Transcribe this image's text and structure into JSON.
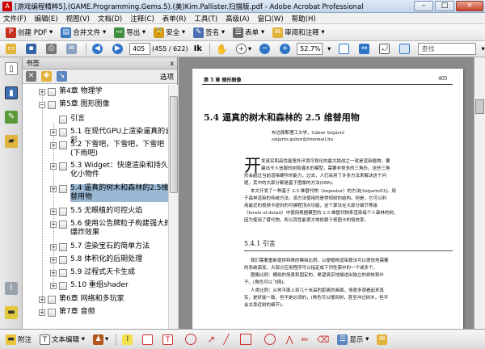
{
  "window": {
    "title": "[游戏编程精粹5].(GAME.Programming.Gems.5).(美)Kim.Pallister.扫描版.pdf - Adobe Acrobat Professional",
    "min": "–",
    "max": "□",
    "close": "×"
  },
  "menu": [
    "文件(F)",
    "编辑(E)",
    "视图(V)",
    "文档(D)",
    "注释(C)",
    "表单(R)",
    "工具(T)",
    "高级(A)",
    "窗口(W)",
    "帮助(H)"
  ],
  "toolbar1": {
    "create": "创建 PDF",
    "combine": "合并文件",
    "export": "导出",
    "secure": "安全",
    "sign": "签名",
    "forms": "表单",
    "review": "审阅和注释"
  },
  "toolbar2": {
    "page_current": "405",
    "page_total": "(455 / 622)",
    "zoom": "52.7%",
    "search_placeholder": "查找"
  },
  "panel": {
    "title": "书签",
    "close": "x",
    "options": "选项"
  },
  "bookmarks": [
    {
      "label": "第4章 物理学",
      "level": 1,
      "expander": "+"
    },
    {
      "label": "第5章 图形图像",
      "level": 1,
      "expander": "−"
    },
    {
      "label": "引言",
      "level": 2,
      "expander": ""
    },
    {
      "label": "5.1 在现代GPU上渲染逼真的云彩",
      "level": 2,
      "expander": "+"
    },
    {
      "label": "5.2 下雪吧，下雪吧，下雪吧(下雨吧)",
      "level": 2,
      "expander": "+"
    },
    {
      "label": "5.3 Widget：快速渲染和持久化小物件",
      "level": 2,
      "expander": "+"
    },
    {
      "label": "5.4 逼真的树木和森林的2.5维替用物",
      "level": 2,
      "expander": "+"
    },
    {
      "label": "5.5 无眼植的可控火焰",
      "level": 2,
      "expander": "+"
    },
    {
      "label": "5.6 使用公告牌粒子构建强大的爆炸效果",
      "level": 2,
      "expander": "+"
    },
    {
      "label": "5.7 渲染宝石的简单方法",
      "level": 2,
      "expander": "+"
    },
    {
      "label": "5.8 体积化的后期处理",
      "level": 2,
      "expander": "+"
    },
    {
      "label": "5.9 过程式天卡生成",
      "level": 2,
      "expander": "+"
    },
    {
      "label": "5.10 重组shader",
      "level": 2,
      "expander": "+"
    },
    {
      "label": "第6章 网络和多玩家",
      "level": 1,
      "expander": "+"
    },
    {
      "label": "第7章 音频",
      "level": 1,
      "expander": "+"
    }
  ],
  "page": {
    "header_left": "第 5 章  图形图像",
    "header_right": "405",
    "section_title": "5.4  逼真的树木和森林的 2.5 维替用物",
    "author_line": "布达佩斯理工大学，Gábor Szijártó",
    "email": "szijarto.gabor@freemail.hu",
    "dropcap": "开",
    "para1_lines": [
      "发真实和高性能室外环境可视化的最大挑战之一就是渲染植物。要",
      "建出令人信服的树和灌木的模型，需要非常多的三角形。这些三角",
      "形会超过当前渲染硬件的能力，过去，人们采用了许多方法来解决这个问",
      "题，其中的大部分都是基于图像的方法(IBR)。"
    ],
    "para2_lines": [
      "本文开发了一种基于 2.5 维替代物（impostor）的方法[Szijarto03]。用",
      "于森林渲染的传统方法，该方法使用的是常规树的结构。但是，它可以利",
      "用最近的视频卡提供的可编程顶点功能，这个算法在大部分细节等级",
      "（levels of detail）中使用根据模型的 2.5 维替代物来渲染每个人森林的树，",
      "因为使用了替代物，所以其性能很大地依赖于视图卡的填充率。"
    ],
    "subsection_title": "5.4.1  引言",
    "para3_lines": [
      "我们需要重新提供特殊的模拟比例，以便植物渲染算法可以很快地需要",
      "的系统演变。大部分应用程序可以指定成下列性需中的一个或多个。"
    ],
    "para4_lines": [
      "图像比例：模拟的场景和固定的，希望真实地描述出独立的树枝和叶",
      "子。(角色可以飞翔)。"
    ],
    "para5_lines": [
      "人类比例：从地平面上到几十米高的距离的画面，场景多观看起来真",
      "实，是好能一致，但不是必须的，(角色可以慢到树，甚至冲过树木，但不",
      "会太靠近树的细节)。"
    ]
  },
  "bottombar": {
    "attach": "附注",
    "text_edit": "文本编辑",
    "show": "显示"
  }
}
